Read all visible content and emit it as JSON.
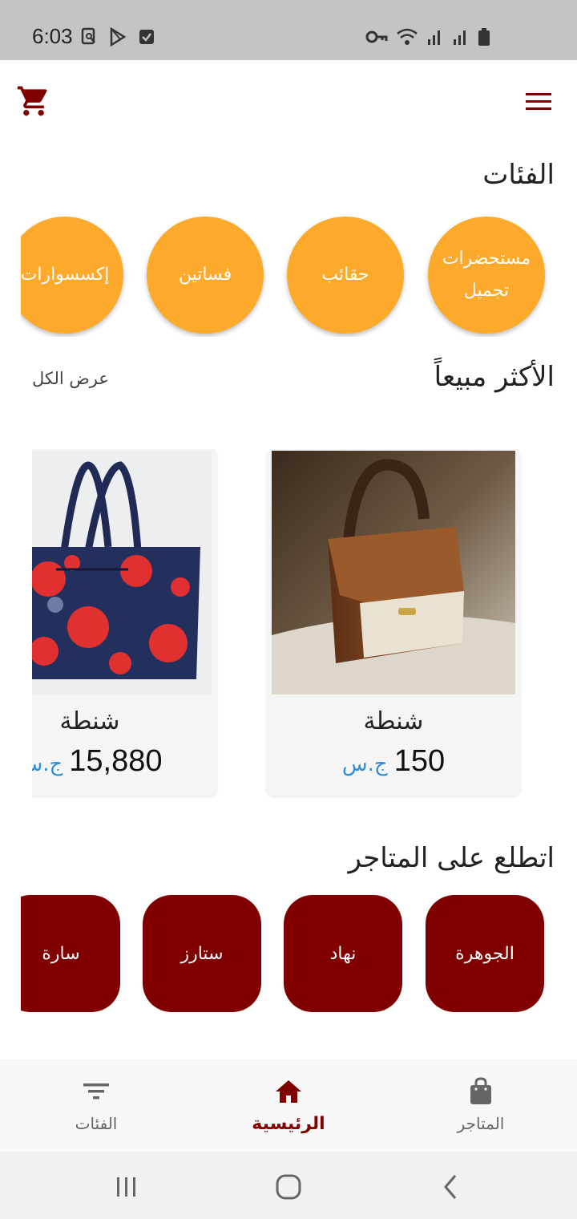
{
  "status_bar": {
    "time": "6:03",
    "left_icons": [
      "screenshot-icon",
      "play-store-icon",
      "checkbox-icon"
    ],
    "right_icons": [
      "vpn-key-icon",
      "wifi-icon",
      "signal-icon",
      "signal-icon",
      "battery-icon"
    ]
  },
  "app_bar": {
    "cart_icon": "cart-icon",
    "menu_icon": "menu-icon"
  },
  "categories": {
    "title": "الفئات",
    "items": [
      {
        "label": "مستحضرات تجميل"
      },
      {
        "label": "حقائب"
      },
      {
        "label": "فساتين"
      },
      {
        "label": "إكسسوارات"
      }
    ]
  },
  "best_sellers": {
    "title": "الأكثر مبيعاً",
    "see_all": "عرض الكل",
    "products": [
      {
        "name": "شنطة",
        "price": "150",
        "currency": "ج.س"
      },
      {
        "name": "شنطة",
        "price": "15,880",
        "currency": "ج.س"
      }
    ]
  },
  "stores": {
    "title": "اتطلع على المتاجر",
    "items": [
      {
        "label": "الجوهرة"
      },
      {
        "label": "نهاد"
      },
      {
        "label": "ستارز"
      },
      {
        "label": "سارة"
      }
    ]
  },
  "bottom_nav": {
    "items": [
      {
        "label": "المتاجر",
        "icon": "shopping-bag-icon"
      },
      {
        "label": "الرئيسية",
        "icon": "home-icon",
        "active": true
      },
      {
        "label": "الفئات",
        "icon": "filter-icon"
      }
    ]
  },
  "colors": {
    "accent": "#800000",
    "category": "#fda92b",
    "currency": "#2f8fd6"
  }
}
